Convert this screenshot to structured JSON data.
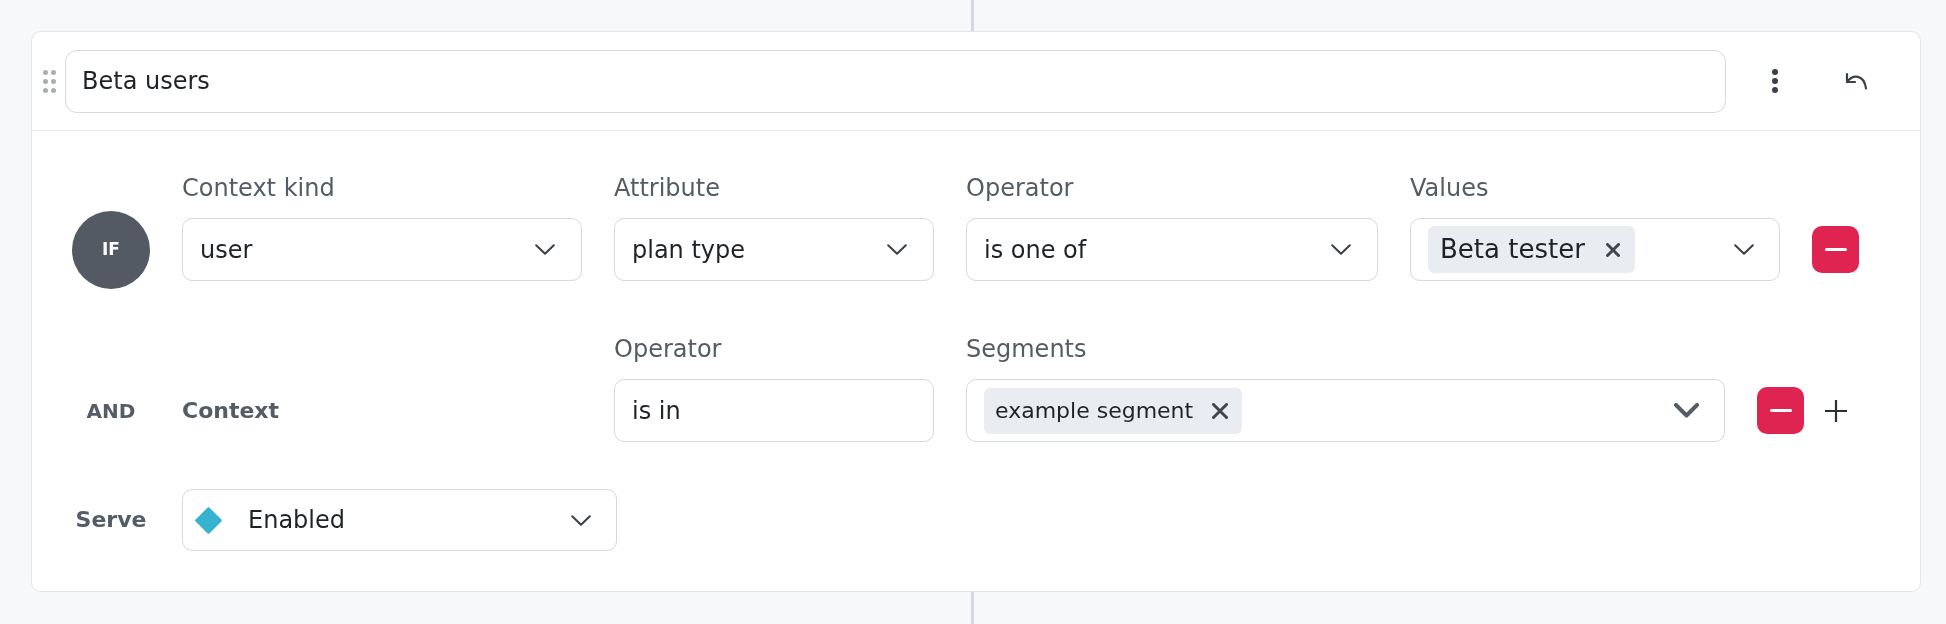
{
  "rule": {
    "name": "Beta users"
  },
  "clauses": [
    {
      "kind": "attribute",
      "connector": "IF",
      "fields": [
        {
          "kind": "select",
          "label": "Context kind",
          "value": "user"
        },
        {
          "kind": "select",
          "label": "Attribute",
          "value": "plan type"
        },
        {
          "kind": "select",
          "label": "Operator",
          "value": "is one of"
        },
        {
          "kind": "multiselect",
          "label": "Values",
          "tags": [
            "Beta tester"
          ]
        }
      ]
    },
    {
      "kind": "segment",
      "connector": "AND",
      "context": "Context",
      "fields": [
        {
          "kind": "text",
          "label": "Operator",
          "value": "is in"
        },
        {
          "kind": "multiselect",
          "label": "Segments",
          "tags": [
            "example segment"
          ]
        }
      ]
    }
  ],
  "serve": {
    "label": "Serve",
    "value": "Enabled"
  }
}
